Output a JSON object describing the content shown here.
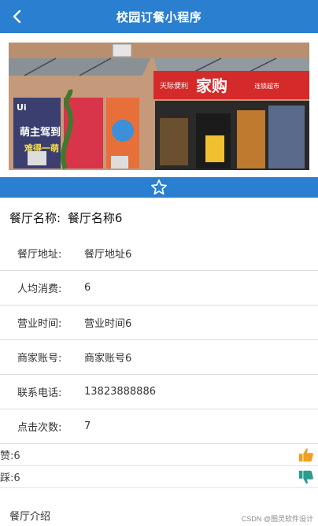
{
  "header": {
    "title": "校园订餐小程序",
    "background": "#2b7fd0"
  },
  "banner": {
    "sign_left": "天际便利",
    "sign_main": "家购",
    "sign_right": "连锁超市",
    "poster_text_1": "萌主驾到",
    "poster_text_2": "难得一萌",
    "poster_badge": "Ui"
  },
  "restaurant": {
    "name_label": "餐厅名称:",
    "name_value": "餐厅名称6"
  },
  "info": [
    {
      "label": "餐厅地址:",
      "value": "餐厅地址6"
    },
    {
      "label": "人均消费:",
      "value": "6"
    },
    {
      "label": "营业时间:",
      "value": "营业时间6"
    },
    {
      "label": "商家账号:",
      "value": "商家账号6"
    },
    {
      "label": "联系电话:",
      "value": "13823888886"
    },
    {
      "label": "点击次数:",
      "value": "7"
    }
  ],
  "votes": {
    "like_text": "赞:6",
    "dislike_text": "踩:6",
    "like_color": "#f0a020",
    "dislike_color": "#2a9d8f"
  },
  "intro_label": "餐厅介绍",
  "watermark": "CSDN @图灵软件设计"
}
